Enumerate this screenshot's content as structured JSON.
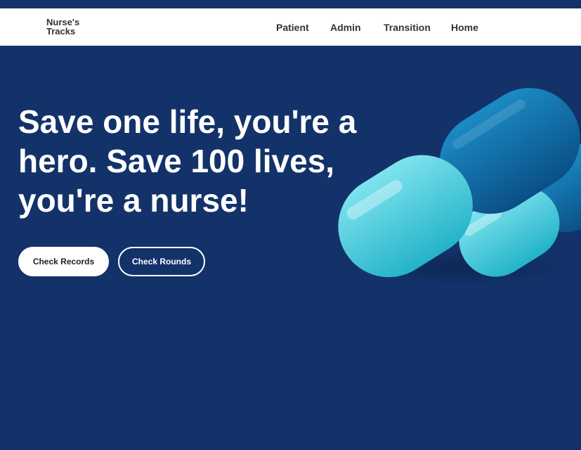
{
  "brand": {
    "line1": "Nurse's",
    "line2": "Tracks"
  },
  "nav": {
    "patient": "Patient",
    "admin": "Admin",
    "transition": "Transition",
    "home": "Home"
  },
  "hero": {
    "line1": "Save one life, you're a",
    "line2": "hero. Save 100 lives,",
    "line3": "you're a nurse!",
    "primary_button": "Check Records",
    "secondary_button": "Check Rounds"
  },
  "colors": {
    "background": "#13326a",
    "navbar": "#ffffff",
    "capsule_dark": "#0d6fa8",
    "capsule_light": "#3cc8d8"
  },
  "icons": {
    "hero_image": "capsule-pills-image"
  }
}
